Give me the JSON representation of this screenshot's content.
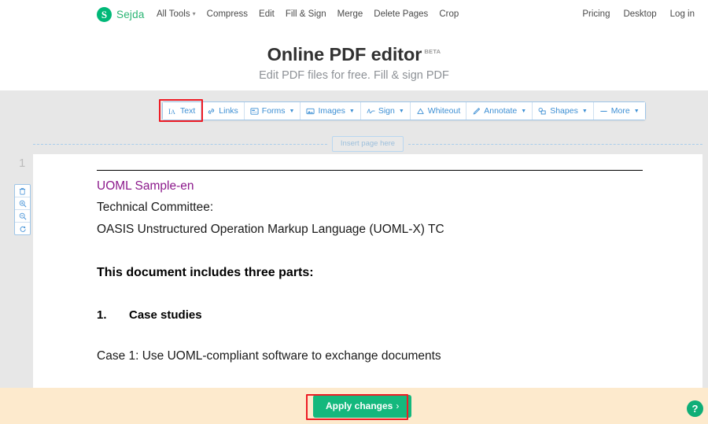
{
  "brand": {
    "logo_letter": "S",
    "name": "Sejda"
  },
  "nav": {
    "left_items": [
      {
        "label": "All Tools",
        "has_caret": true
      },
      {
        "label": "Compress",
        "has_caret": false
      },
      {
        "label": "Edit",
        "has_caret": false
      },
      {
        "label": "Fill & Sign",
        "has_caret": false
      },
      {
        "label": "Merge",
        "has_caret": false
      },
      {
        "label": "Delete Pages",
        "has_caret": false
      },
      {
        "label": "Crop",
        "has_caret": false
      }
    ],
    "right_items": [
      {
        "label": "Pricing"
      },
      {
        "label": "Desktop"
      },
      {
        "label": "Log in"
      }
    ]
  },
  "hero": {
    "title": "Online PDF editor",
    "badge": "BETA",
    "subtitle": "Edit PDF files for free. Fill & sign PDF"
  },
  "toolbar": {
    "items": [
      {
        "label": "Text",
        "icon": "text-cursor-icon",
        "caret": false,
        "selected": true
      },
      {
        "label": "Links",
        "icon": "link-icon",
        "caret": false,
        "selected": false
      },
      {
        "label": "Forms",
        "icon": "form-icon",
        "caret": true,
        "selected": false
      },
      {
        "label": "Images",
        "icon": "image-icon",
        "caret": true,
        "selected": false
      },
      {
        "label": "Sign",
        "icon": "signature-icon",
        "caret": true,
        "selected": false
      },
      {
        "label": "Whiteout",
        "icon": "whiteout-icon",
        "caret": false,
        "selected": false
      },
      {
        "label": "Annotate",
        "icon": "pen-icon",
        "caret": true,
        "selected": false
      },
      {
        "label": "Shapes",
        "icon": "shapes-icon",
        "caret": true,
        "selected": false
      },
      {
        "label": "More",
        "icon": "more-icon",
        "caret": true,
        "selected": false
      }
    ]
  },
  "editor": {
    "insert_page_label": "Insert page here",
    "page_number": "1",
    "page_tools": [
      {
        "name": "delete-page-icon"
      },
      {
        "name": "zoom-in-icon"
      },
      {
        "name": "zoom-out-icon"
      },
      {
        "name": "rotate-page-icon"
      }
    ]
  },
  "document": {
    "title_link": "UOML Sample-en",
    "lines": [
      "Technical Committee:",
      "OASIS Unstructured Operation Markup Language (UOML-X) TC"
    ],
    "heading": "This document includes three parts:",
    "list_item_number": "1.",
    "list_item_text": "Case studies",
    "faded_line": "Case 1: Use UOML-compliant software to exchange documents"
  },
  "actionbar": {
    "apply_label": "Apply changes",
    "apply_chevron": "›",
    "help_label": "?"
  },
  "colors": {
    "brand_green": "#29b473",
    "accent_blue": "#3d8fd4",
    "highlight_red": "#ee1c25",
    "apply_green": "#14b87d",
    "actionbar_bg": "#fdeacd",
    "editor_bg": "#e7e7e7",
    "doc_link_purple": "#8c1a8c"
  }
}
